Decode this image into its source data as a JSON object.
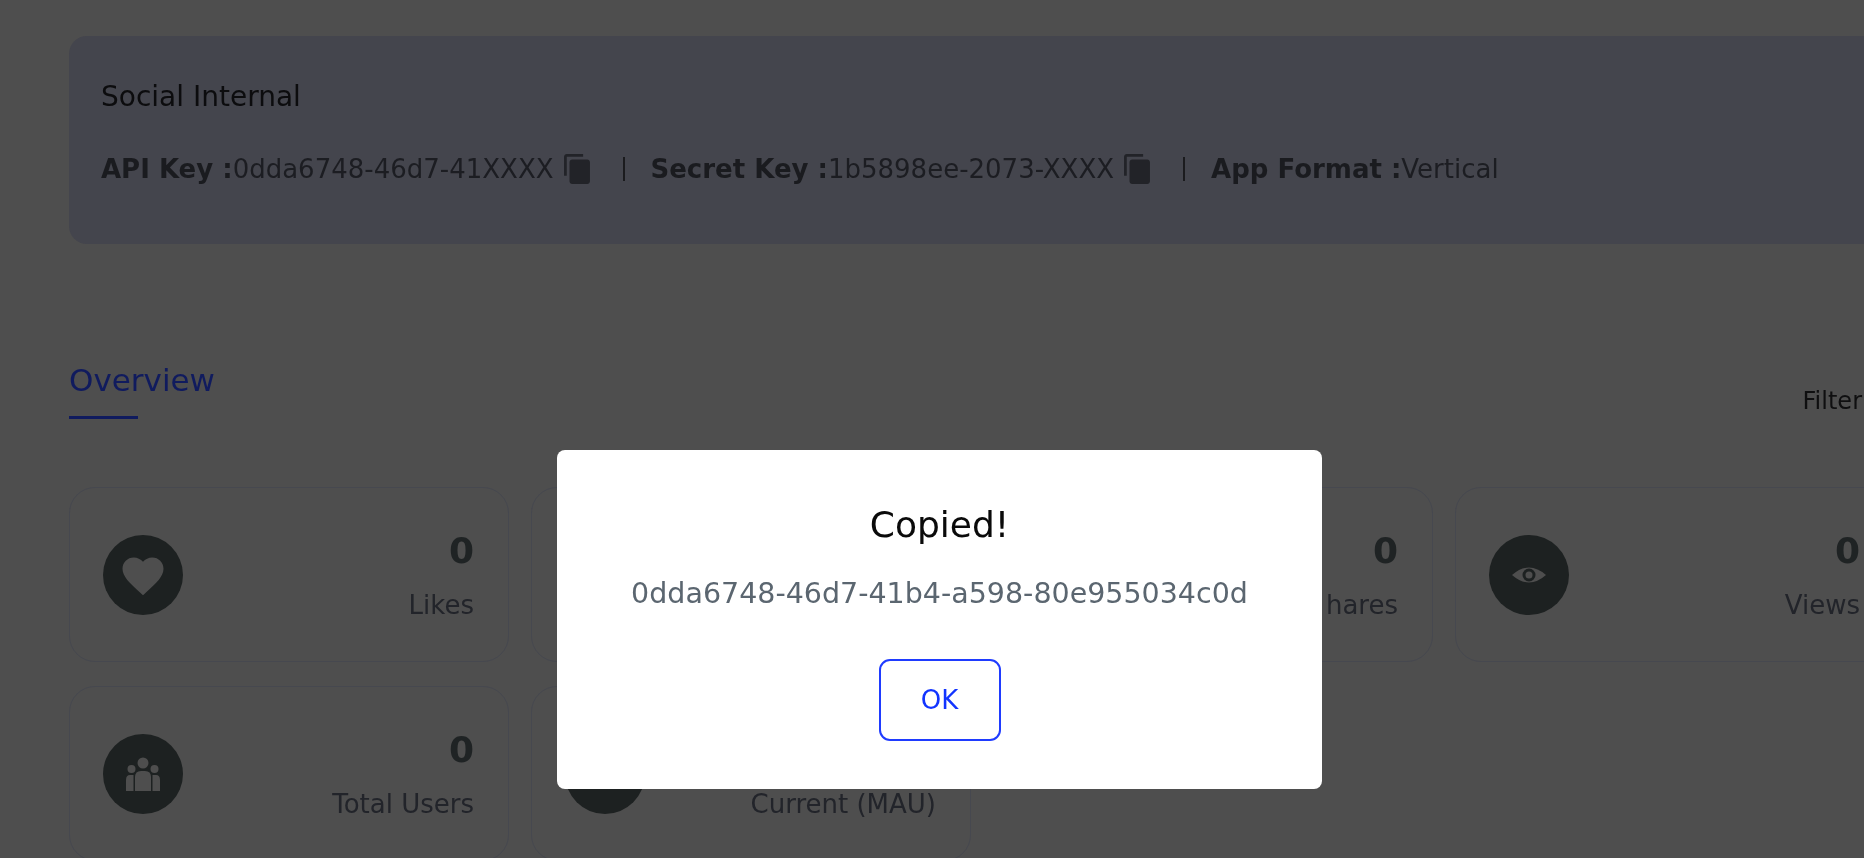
{
  "app_card": {
    "title": "Social Internal",
    "keys": [
      {
        "text": "**API Key :**0dda6748-46d7-41XXXX",
        "copyable": true
      },
      {
        "text": "**Secret Key :**1b5898ee-2073-XXXX",
        "copyable": true
      },
      {
        "text": "**App Format :**Vertical",
        "copyable": false
      }
    ]
  },
  "tabs": [
    {
      "label": "Overview",
      "selected": true
    }
  ],
  "filter": {
    "label": "Filter"
  },
  "stat_cards": [
    {
      "kind": "stat",
      "value": "0",
      "label": "Likes"
    },
    {
      "kind": "covered"
    },
    {
      "kind": "stat",
      "value": "0",
      "label": "hares"
    },
    {
      "kind": "stat",
      "value": "0",
      "label": "Views"
    },
    {
      "kind": "stat",
      "value": "0",
      "label": "Total Users"
    },
    {
      "kind": "stat",
      "label": "Current (MAU)"
    }
  ],
  "dialog": {
    "title": "Copied!",
    "message": "0dda6748-46d7-41b4-a598-80e955034c0d",
    "buttons": [
      "OK"
    ]
  }
}
